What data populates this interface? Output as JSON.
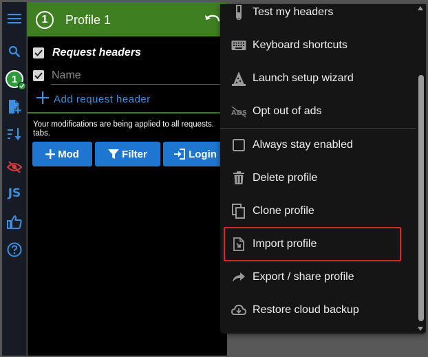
{
  "app": {
    "profile_number": "1",
    "profile_name": "Profile 1"
  },
  "sidebar": {
    "items": [
      {
        "name": "menu",
        "icon": "hamburger-icon"
      },
      {
        "name": "search",
        "icon": "search-icon"
      },
      {
        "name": "profile-1",
        "label": "1"
      },
      {
        "name": "add-profile",
        "icon": "file-add-icon"
      },
      {
        "name": "sort",
        "icon": "sort-icon"
      },
      {
        "name": "hide",
        "icon": "eye-off-icon"
      },
      {
        "name": "js",
        "label": "JS"
      },
      {
        "name": "like",
        "icon": "thumbs-up-icon"
      },
      {
        "name": "help",
        "icon": "help-icon"
      }
    ]
  },
  "main": {
    "section_title": "Request headers",
    "name_placeholder": "Name",
    "add_header_label": "Add request header",
    "notice": "Your modifications are being applied to all requests.",
    "notice_line2": "tabs.",
    "buttons": {
      "mod": "Mod",
      "filter": "Filter",
      "login": "Login"
    }
  },
  "menu": {
    "items": [
      {
        "label": "Test my headers",
        "icon": "test-tube-icon"
      },
      {
        "label": "Keyboard shortcuts",
        "icon": "keyboard-icon"
      },
      {
        "label": "Launch setup wizard",
        "icon": "wizard-icon"
      },
      {
        "label": "Opt out of ads",
        "icon": "ads-off-icon"
      },
      {
        "label": "Always stay enabled",
        "icon": "checkbox-icon"
      },
      {
        "label": "Delete profile",
        "icon": "trash-icon"
      },
      {
        "label": "Clone profile",
        "icon": "clone-icon"
      },
      {
        "label": "Import profile",
        "icon": "import-icon"
      },
      {
        "label": "Export / share profile",
        "icon": "share-icon"
      },
      {
        "label": "Restore cloud backup",
        "icon": "cloud-icon"
      }
    ]
  },
  "colors": {
    "header_green": "#3e7f22",
    "accent_blue": "#1f76d1",
    "highlight_red": "#d9262b",
    "sidebar_bg": "#171b26"
  }
}
